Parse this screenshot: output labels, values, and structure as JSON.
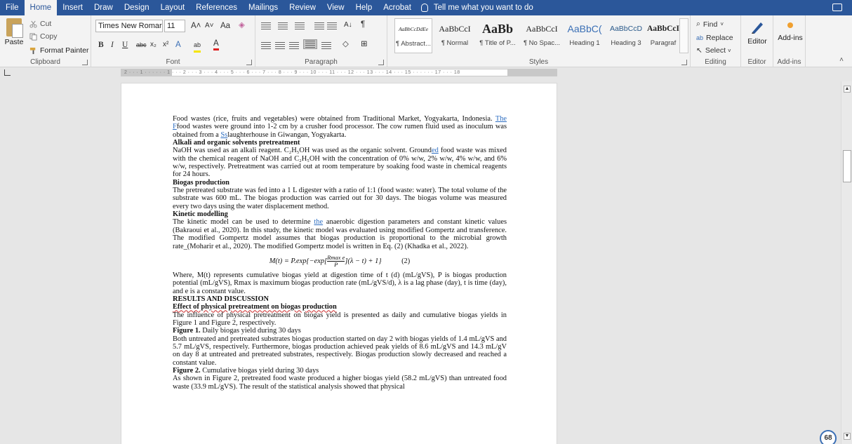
{
  "menu": {
    "tabs": [
      "File",
      "Home",
      "Insert",
      "Draw",
      "Design",
      "Layout",
      "References",
      "Mailings",
      "Review",
      "View",
      "Help",
      "Acrobat"
    ],
    "active": "Home",
    "tell_me": "Tell me what you want to do"
  },
  "clipboard": {
    "paste": "Paste",
    "cut": "Cut",
    "copy": "Copy",
    "format_painter": "Format Painter",
    "label": "Clipboard"
  },
  "font": {
    "family": "Times New Romar",
    "size": "11",
    "label": "Font"
  },
  "paragraph": {
    "label": "Paragraph"
  },
  "styles": {
    "items": [
      {
        "sample": "AaBbCcDdEe",
        "name": "¶ Abstract..."
      },
      {
        "sample": "AaBbCcI",
        "name": "¶ Normal"
      },
      {
        "sample": "AaBb",
        "name": "¶ Title of P..."
      },
      {
        "sample": "AaBbCcI",
        "name": "¶ No Spac..."
      },
      {
        "sample": "AaBbC(",
        "name": "Heading 1"
      },
      {
        "sample": "AaBbCcD",
        "name": "Heading 3"
      },
      {
        "sample": "AaBbCcI",
        "name": "Paragraf"
      }
    ],
    "label": "Styles"
  },
  "editing": {
    "find": "Find",
    "replace": "Replace",
    "select": "Select",
    "label": "Editing"
  },
  "editor": {
    "button": "Editor",
    "label": "Editor"
  },
  "addins": {
    "button": "Add-ins",
    "label": "Add-ins"
  },
  "ruler": {
    "text": "2 · · · 1 · · · · · · 1 · · · 2 · · · 3 · · · 4 · · · 5 · · · 6 · · · 7 · · · 8 · · · 9 · · · 10 · · · 11 · · · 12 · · · 13 · · · 14 · · · 15 · · · · · · 17 · · · 18"
  },
  "document": {
    "p1": {
      "a": "Food wastes (rice, fruits and vegetables) were obtained from Traditional Market, Yogyakarta, Indonesia. ",
      "link1": "The F",
      "b": "food wastes were ground into 1-2 cm by a crusher food processor. The cow rumen fluid used as inoculum was obtained from a ",
      "link2": "Ss",
      "c": "laughterhouse in Giwangan, Yogyakarta."
    },
    "h_alkali": "Alkali and organic solvents pretreatment",
    "p2": {
      "a": "NaOH was used as an alkali reagent. C₂H₅OH was used as the organic solvent. Ground",
      "link": "ed",
      "b": " food waste was mixed with the chemical reagent of NaOH and C₂H₅OH with the concentration of 0% w/w, 2% w/w, 4% w/w, and 6% w/w, respectively. Pretreatment was carried out at room temperature by soaking food waste in chemical reagents for 24 hours."
    },
    "h_biogas": "Biogas production",
    "p3": "The pretreated substrate was fed into a 1 L digester with a ratio of 1:1 (food waste: water). The total volume of the substrate was 600 mL. The biogas production was carried out for 30 days. The biogas volume was measured every two days using the water displacement method.",
    "h_kinetic": "Kinetic modelling",
    "p4": {
      "a": "The kinetic model can be used to determine ",
      "link": "the",
      "b": " anaerobic digestion parameters and constant kinetic values (Bakraoui et al., 2020). In this study, the kinetic model was evaluated using modified Gompertz and transference. The modified Gompertz model assumes that biogas production is proportional to the microbial growth rate_(Moharir et al., 2020). The modified Gompertz model is written in Eq. (2) (Khadka et al., 2022)."
    },
    "equation": {
      "left": "M(t) = P.exp{−exp[",
      "num": "Rmax e",
      "den": "P",
      "right": "](λ − t) + 1}",
      "number": "(2)"
    },
    "p5": "Where, M(t) represents cumulative biogas yield at digestion time of t (d) (mL/gVS), P is biogas production potential (mL/gVS), Rmax is maximum biogas production rate (mL/gVS/d), λ is a lag phase (day), t is time (day), and e is a constant value.",
    "h_results": "RESULTS AND DISCUSSION",
    "h_effect": "Effect of physical pretreatment on biogas production",
    "p6": "The influence of physical pretreatment on biogas yield is presented as daily and cumulative biogas yields in Figure 1 and Figure 2, respectively.",
    "fig1": {
      "label": "Figure 1.",
      "text": " Daily biogas yield during 30 days"
    },
    "p7": "Both untreated and pretreated substrates biogas production started on day 2 with biogas yields of 1.4 mL/gVS and 5.7 mL/gVS, respectively. Furthermore, biogas production achieved peak yields of 8.6 mL/gVS and 14.3 mL/gV on day 8 at untreated and pretreated substrates, respectively. Biogas production slowly decreased and reached a constant value.",
    "fig2": {
      "label": "Figure 2.",
      "text": " Cumulative biogas yield during 30 days"
    },
    "p8": "As shown in Figure 2, pretreated food waste produced a higher biogas yield (58.2 mL/gVS) than untreated food waste (33.9 mL/gVS). The result of the statistical analysis showed that physical"
  },
  "badge": "68"
}
